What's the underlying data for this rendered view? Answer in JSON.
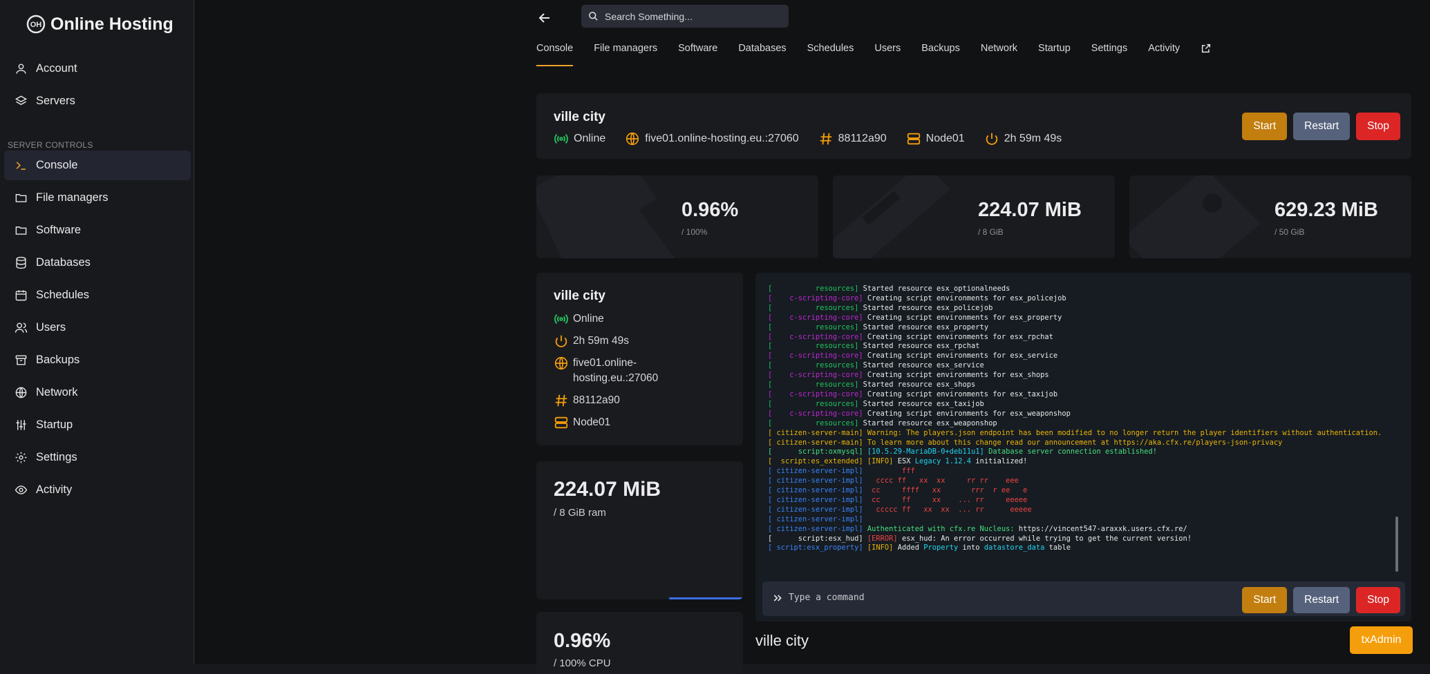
{
  "brand": {
    "name": "Online Hosting",
    "logo_text": "OH"
  },
  "sidebar": {
    "top_items": [
      {
        "label": "Account",
        "icon": "user-icon"
      },
      {
        "label": "Servers",
        "icon": "layers-icon"
      }
    ],
    "section_label": "SERVER CONTROLS",
    "items": [
      {
        "label": "Console",
        "icon": "terminal-icon",
        "active": true
      },
      {
        "label": "File managers",
        "icon": "folder-icon"
      },
      {
        "label": "Software",
        "icon": "folder-icon"
      },
      {
        "label": "Databases",
        "icon": "database-icon"
      },
      {
        "label": "Schedules",
        "icon": "calendar-icon"
      },
      {
        "label": "Users",
        "icon": "users-icon"
      },
      {
        "label": "Backups",
        "icon": "archive-icon"
      },
      {
        "label": "Network",
        "icon": "globe-icon"
      },
      {
        "label": "Startup",
        "icon": "sliders-icon"
      },
      {
        "label": "Settings",
        "icon": "gear-icon"
      },
      {
        "label": "Activity",
        "icon": "eye-icon"
      }
    ]
  },
  "search": {
    "placeholder": "Search Something..."
  },
  "tabs": [
    "Console",
    "File managers",
    "Software",
    "Databases",
    "Schedules",
    "Users",
    "Backups",
    "Network",
    "Startup",
    "Settings",
    "Activity"
  ],
  "server": {
    "name": "ville city",
    "status": "Online",
    "address": "five01.online-hosting.eu.:27060",
    "address_wrapped": [
      "five01.online-",
      "hosting.eu.:27060"
    ],
    "id": "88112a90",
    "node": "Node01",
    "uptime": "2h 59m 49s"
  },
  "buttons": {
    "start": "Start",
    "restart": "Restart",
    "stop": "Stop",
    "txadmin": "txAdmin"
  },
  "stats": [
    {
      "value": "0.96%",
      "sub": "/ 100%"
    },
    {
      "value": "224.07 MiB",
      "sub": "/ 8 GiB"
    },
    {
      "value": "629.23 MiB",
      "sub": "/ 50 GiB"
    }
  ],
  "ram_card": {
    "value": "224.07 MiB",
    "sub": "/ 8 GiB ram",
    "fill_fraction": 0.027
  },
  "cpu_card": {
    "value": "0.96%",
    "sub": "/ 100% CPU"
  },
  "console": {
    "placeholder": "Type a command",
    "lines": [
      [
        [
          "[          ",
          "c-g"
        ],
        [
          "resources",
          "c-g"
        ],
        [
          "] ",
          "c-g"
        ],
        [
          "Started resource esx_optionalneeds",
          ""
        ]
      ],
      [
        [
          "[    ",
          "c-m"
        ],
        [
          "c-scripting-core",
          "c-m"
        ],
        [
          "] ",
          "c-m"
        ],
        [
          "Creating script environments for esx_policejob",
          ""
        ]
      ],
      [
        [
          "[          ",
          "c-g"
        ],
        [
          "resources",
          "c-g"
        ],
        [
          "] ",
          "c-g"
        ],
        [
          "Started resource esx_policejob",
          ""
        ]
      ],
      [
        [
          "[    ",
          "c-m"
        ],
        [
          "c-scripting-core",
          "c-m"
        ],
        [
          "] ",
          "c-m"
        ],
        [
          "Creating script environments for esx_property",
          ""
        ]
      ],
      [
        [
          "[          ",
          "c-g"
        ],
        [
          "resources",
          "c-g"
        ],
        [
          "] ",
          "c-g"
        ],
        [
          "Started resource esx_property",
          ""
        ]
      ],
      [
        [
          "[    ",
          "c-m"
        ],
        [
          "c-scripting-core",
          "c-m"
        ],
        [
          "] ",
          "c-m"
        ],
        [
          "Creating script environments for esx_rpchat",
          ""
        ]
      ],
      [
        [
          "[          ",
          "c-g"
        ],
        [
          "resources",
          "c-g"
        ],
        [
          "] ",
          "c-g"
        ],
        [
          "Started resource esx_rpchat",
          ""
        ]
      ],
      [
        [
          "[    ",
          "c-m"
        ],
        [
          "c-scripting-core",
          "c-m"
        ],
        [
          "] ",
          "c-m"
        ],
        [
          "Creating script environments for esx_service",
          ""
        ]
      ],
      [
        [
          "[          ",
          "c-g"
        ],
        [
          "resources",
          "c-g"
        ],
        [
          "] ",
          "c-g"
        ],
        [
          "Started resource esx_service",
          ""
        ]
      ],
      [
        [
          "[    ",
          "c-m"
        ],
        [
          "c-scripting-core",
          "c-m"
        ],
        [
          "] ",
          "c-m"
        ],
        [
          "Creating script environments for esx_shops",
          ""
        ]
      ],
      [
        [
          "[          ",
          "c-g"
        ],
        [
          "resources",
          "c-g"
        ],
        [
          "] ",
          "c-g"
        ],
        [
          "Started resource esx_shops",
          ""
        ]
      ],
      [
        [
          "[    ",
          "c-m"
        ],
        [
          "c-scripting-core",
          "c-m"
        ],
        [
          "] ",
          "c-m"
        ],
        [
          "Creating script environments for esx_taxijob",
          ""
        ]
      ],
      [
        [
          "[          ",
          "c-g"
        ],
        [
          "resources",
          "c-g"
        ],
        [
          "] ",
          "c-g"
        ],
        [
          "Started resource esx_taxijob",
          ""
        ]
      ],
      [
        [
          "[    ",
          "c-m"
        ],
        [
          "c-scripting-core",
          "c-m"
        ],
        [
          "] ",
          "c-m"
        ],
        [
          "Creating script environments for esx_weaponshop",
          ""
        ]
      ],
      [
        [
          "[          ",
          "c-g"
        ],
        [
          "resources",
          "c-g"
        ],
        [
          "] ",
          "c-g"
        ],
        [
          "Started resource esx_weaponshop",
          ""
        ]
      ],
      [
        [
          "[ citizen-server-main] ",
          "c-y"
        ],
        [
          "Warning: The players.json endpoint has been modified to no longer return the player identifiers without authentication.",
          "c-y"
        ]
      ],
      [
        [
          "[ citizen-server-main] ",
          "c-y"
        ],
        [
          "To learn more about this change read our announcement at https://aka.cfx.re/players-json-privacy",
          "c-y"
        ]
      ],
      [
        [
          "[      ",
          "c-gr"
        ],
        [
          "script:oxmysql",
          "c-gr"
        ],
        [
          "] ",
          "c-gr"
        ],
        [
          "[10.5.29-MariaDB-0+deb11u1] ",
          "c-cy"
        ],
        [
          "Database server connection established!",
          "c-gr"
        ]
      ],
      [
        [
          "[  script:es_extended] ",
          "c-y"
        ],
        [
          "[INFO] ",
          "c-y"
        ],
        [
          "ESX ",
          ""
        ],
        [
          "Legacy 1.12.4",
          "c-cy"
        ],
        [
          " initialized!",
          ""
        ]
      ],
      [
        [
          "[ citizen-server-impl] ",
          "c-b"
        ],
        [
          "        fff",
          "c-r"
        ]
      ],
      [
        [
          "[ citizen-server-impl] ",
          "c-b"
        ],
        [
          "  cccc ff   xx  xx     rr rr    eee",
          "c-r"
        ]
      ],
      [
        [
          "[ citizen-server-impl] ",
          "c-b"
        ],
        [
          " cc     ffff   xx       rrr  r ee   e",
          "c-r"
        ]
      ],
      [
        [
          "[ citizen-server-impl] ",
          "c-b"
        ],
        [
          " cc     ff     xx    ... rr     eeeee",
          "c-r"
        ]
      ],
      [
        [
          "[ citizen-server-impl] ",
          "c-b"
        ],
        [
          "  ccccc ff   xx  xx  ... rr      eeeee",
          "c-r"
        ]
      ],
      [
        [
          "[ citizen-server-impl] ",
          "c-b"
        ],
        [
          "",
          "c-r"
        ]
      ],
      [
        [
          "[ citizen-server-impl] ",
          "c-b"
        ],
        [
          "Authenticated with cfx.re Nucleus: ",
          "c-gr"
        ],
        [
          "https://vincent547-araxxk.users.cfx.re/",
          ""
        ]
      ],
      [
        [
          "[      script:esx_hud] ",
          ""
        ],
        [
          "[ERROR] ",
          "c-r"
        ],
        [
          "esx_hud: An error occurred while trying to get the current version!",
          ""
        ]
      ],
      [
        [
          "[ script:esx_property] ",
          "c-b"
        ],
        [
          "[INFO] ",
          "c-y"
        ],
        [
          "Added ",
          ""
        ],
        [
          "Property",
          "c-cy"
        ],
        [
          " into ",
          ""
        ],
        [
          "datastore_data",
          "c-cy"
        ],
        [
          " table",
          ""
        ]
      ]
    ]
  },
  "footer": {
    "server_name": "ville city"
  },
  "colors": {
    "accent": "#f1a12a",
    "start": "#c27e0f",
    "restart": "#56627c",
    "stop": "#dc2626",
    "txadmin": "#f59e0b"
  }
}
